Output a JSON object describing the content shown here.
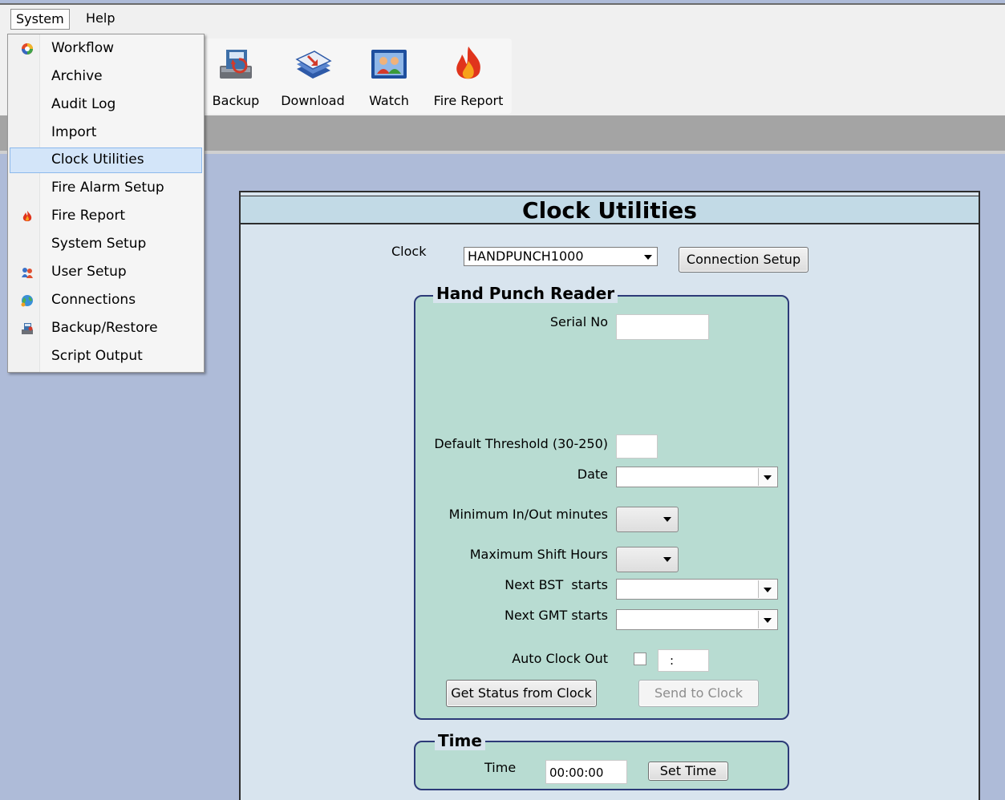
{
  "menubar": {
    "system": "System",
    "help": "Help"
  },
  "toolbar": [
    {
      "label": "Backup",
      "icon": "backup-icon"
    },
    {
      "label": "Download",
      "icon": "download-icon"
    },
    {
      "label": "Watch",
      "icon": "watch-icon"
    },
    {
      "label": "Fire Report",
      "icon": "fire-icon"
    }
  ],
  "system_menu": {
    "items": [
      {
        "label": "Workflow",
        "icon": "workflow-icon"
      },
      {
        "label": "Archive"
      },
      {
        "label": "Audit Log"
      },
      {
        "label": "Import"
      },
      {
        "label": "Clock Utilities",
        "highlighted": true
      },
      {
        "label": "Fire Alarm Setup"
      },
      {
        "label": "Fire Report",
        "icon": "fire-icon"
      },
      {
        "label": "System Setup"
      },
      {
        "label": "User Setup",
        "icon": "users-icon"
      },
      {
        "label": "Connections",
        "icon": "globe-icon"
      },
      {
        "label": "Backup/Restore",
        "icon": "backup-icon"
      },
      {
        "label": "Script Output"
      }
    ]
  },
  "clock_utilities": {
    "title": "Clock Utilities",
    "clock_label": "Clock",
    "clock_value": "HANDPUNCH1000",
    "connection_setup": "Connection Setup",
    "reader": {
      "title": "Hand Punch Reader",
      "serial_no": "Serial No",
      "default_threshold": "Default Threshold (30-250)",
      "date": "Date",
      "min_inout": "Minimum In/Out minutes",
      "max_shift": "Maximum Shift Hours",
      "next_bst": "Next BST  starts",
      "next_gmt": "Next GMT starts",
      "auto_clock_out": "Auto Clock Out",
      "auto_clock_time": ":",
      "get_status": "Get Status from Clock",
      "send_to_clock": "Send to Clock"
    },
    "time_group": {
      "title": "Time",
      "label": "Time",
      "value": "00:00:00",
      "set_time": "Set Time"
    }
  },
  "colors": {
    "background": "#aebbd8",
    "panel": "#d8e4ee",
    "group_fill": "#b8dcd2",
    "group_border": "#2c3a78",
    "menu_highlight": "#d3e5f9"
  }
}
